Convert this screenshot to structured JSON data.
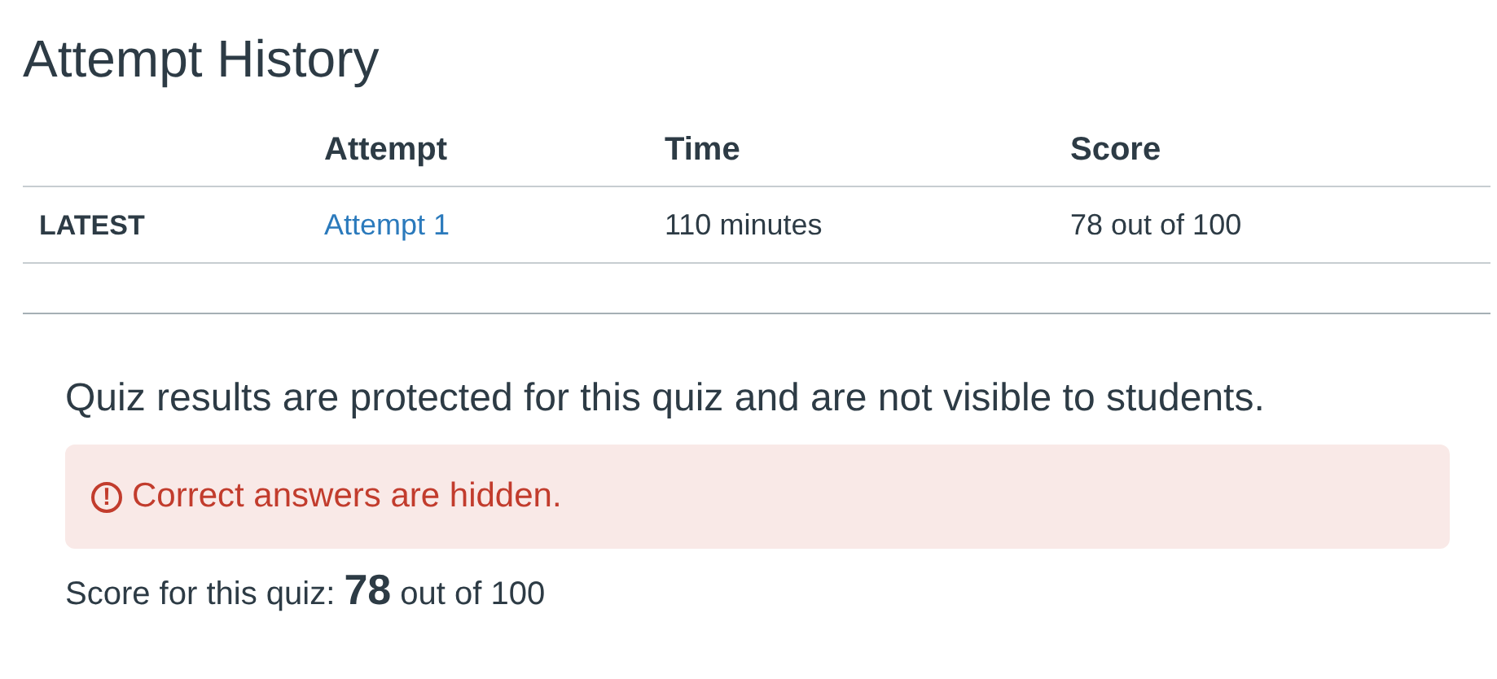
{
  "title": "Attempt History",
  "table": {
    "columns": [
      "",
      "Attempt",
      "Time",
      "Score"
    ],
    "rows": [
      {
        "label": "LATEST",
        "attempt": "Attempt 1",
        "time": "110 minutes",
        "score": "78 out of 100"
      }
    ]
  },
  "notice": "Quiz results are protected for this quiz and are not visible to students.",
  "alert": {
    "icon": "!",
    "text": "Correct answers are hidden."
  },
  "score_line": "Score for this quiz: **78** out of 100"
}
